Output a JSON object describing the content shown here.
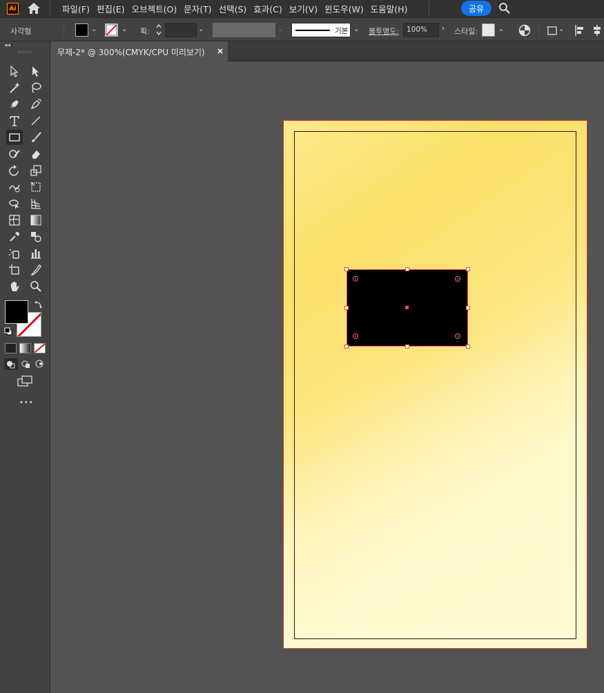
{
  "app": {
    "logo_text": "Ai"
  },
  "menu": {
    "items": [
      "파일(F)",
      "편집(E)",
      "오브젝트(O)",
      "문자(T)",
      "선택(S)",
      "효과(C)",
      "보기(V)",
      "윈도우(W)",
      "도움말(H)"
    ],
    "share_label": "공유"
  },
  "control_bar": {
    "object_type": "사각형",
    "stroke_weight_label": "획:",
    "stroke_profile": "기본",
    "opacity_label": "불투명도:",
    "opacity_value": "100%",
    "style_label": "스타일:",
    "fill_color": "#000000"
  },
  "document": {
    "tab_title": "무제-2* @ 300%(CMYK/CPU 미리보기)",
    "close_symbol": "×"
  },
  "toolbar": {
    "more_label": "•••"
  },
  "colors": {
    "accent": "#1473e6",
    "selection": "#e84a4a",
    "artboard_gradient": [
      "#fde88a",
      "#fbe06a",
      "#fef0a8",
      "#fff6c4"
    ]
  }
}
